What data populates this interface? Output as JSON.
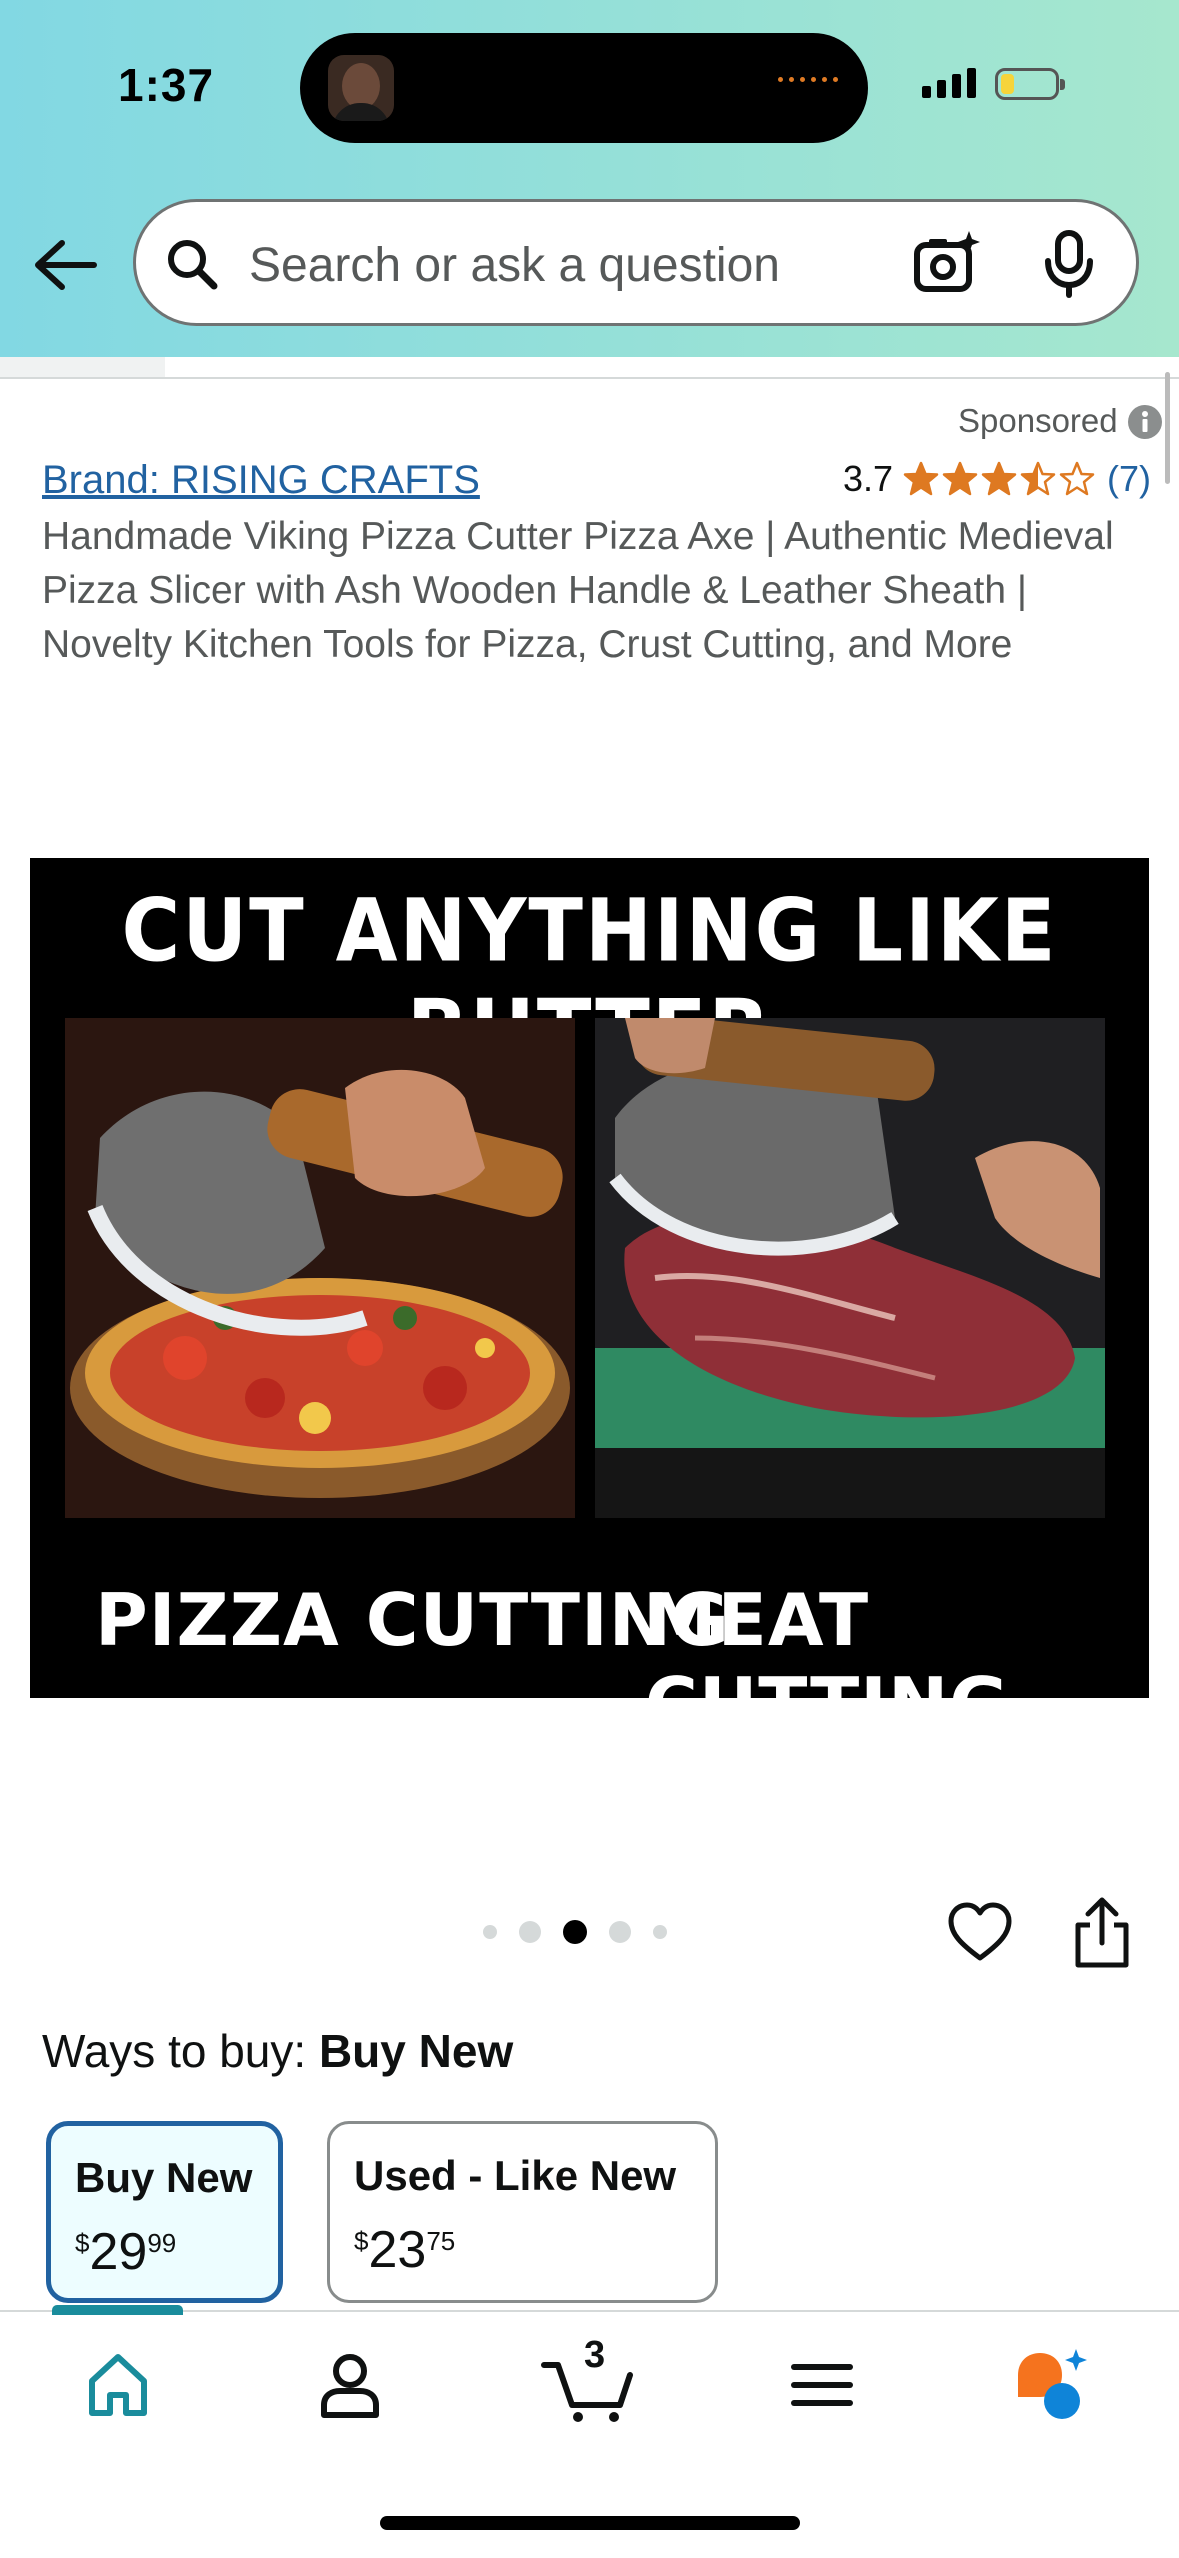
{
  "status_bar": {
    "time": "1:37"
  },
  "search": {
    "placeholder": "Search or ask a question"
  },
  "listing": {
    "sponsored_label": "Sponsored",
    "brand": "Brand: RISING CRAFTS",
    "rating_value": "3.7",
    "rating_stars": 3.5,
    "rating_count": "(7)",
    "title": "Handmade Viking Pizza Cutter Pizza Axe | Authentic Medieval Pizza Slicer with Ash Wooden Handle & Leather Sheath | Novelty Kitchen Tools for Pizza, Crust Cutting, and More"
  },
  "product_image": {
    "headline": "CUT ANYTHING LIKE BUTTER",
    "left_caption": "PIZZA CUTTING",
    "right_caption": "MEAT CUTTING"
  },
  "carousel": {
    "total": 5,
    "active_index": 2
  },
  "ways_to_buy": {
    "label": "Ways to buy:",
    "selected": "Buy New",
    "options": [
      {
        "label": "Buy New",
        "currency": "$",
        "whole": "29",
        "fraction": "99"
      },
      {
        "label": "Used - Like New",
        "currency": "$",
        "whole": "23",
        "fraction": "75"
      }
    ]
  },
  "bottom_nav": {
    "items": [
      "home-icon",
      "account-icon",
      "cart-icon",
      "menu-icon",
      "rufus-icon"
    ],
    "cart_count": "3",
    "active": "home"
  },
  "colors": {
    "header_gradient_start": "#82d8e3",
    "header_gradient_end": "#a6e7ce",
    "link_blue": "#2162a1",
    "star_orange": "#de7921",
    "active_teal": "#1a8c9c",
    "rufus_orange": "#f5731e",
    "rufus_blue": "#0f84d8"
  }
}
